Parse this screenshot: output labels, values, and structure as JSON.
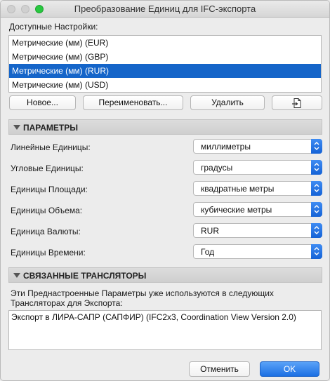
{
  "window": {
    "title": "Преобразование Единиц для IFC-экспорта"
  },
  "presets": {
    "label": "Доступные Настройки:",
    "items": [
      "Метрические (мм) (EUR)",
      "Метрические (мм) (GBP)",
      "Метрические (мм) (RUR)",
      "Метрические (мм) (USD)"
    ],
    "selected_index": 2
  },
  "buttons": {
    "new": "Новое...",
    "rename": "Переименовать...",
    "delete": "Удалить",
    "import_icon": "import-file-icon",
    "cancel": "Отменить",
    "ok": "OK"
  },
  "parameters": {
    "header": "ПАРАМЕТРЫ",
    "rows": [
      {
        "label": "Линейные Единицы:",
        "value": "миллиметры"
      },
      {
        "label": "Угловые Единицы:",
        "value": "градусы"
      },
      {
        "label": "Единицы Площади:",
        "value": "квадратные метры"
      },
      {
        "label": "Единицы Объема:",
        "value": "кубические метры"
      },
      {
        "label": "Единица Валюты:",
        "value": "RUR"
      },
      {
        "label": "Единицы Времени:",
        "value": "Год"
      }
    ]
  },
  "translators": {
    "header": "СВЯЗАННЫЕ ТРАНСЛЯТОРЫ",
    "note_line1": "Эти Преднастроенные Параметры уже используются в следующих",
    "note_line2": "Трансляторах для Экспорта:",
    "entries": [
      "Экспорт в ЛИРА-САПР (САПФИР) (IFC2x3, Coordination View Version 2.0)"
    ]
  },
  "colors": {
    "selection": "#1565c9",
    "accent": "#1b6fe3",
    "window_bg": "#ececec"
  }
}
